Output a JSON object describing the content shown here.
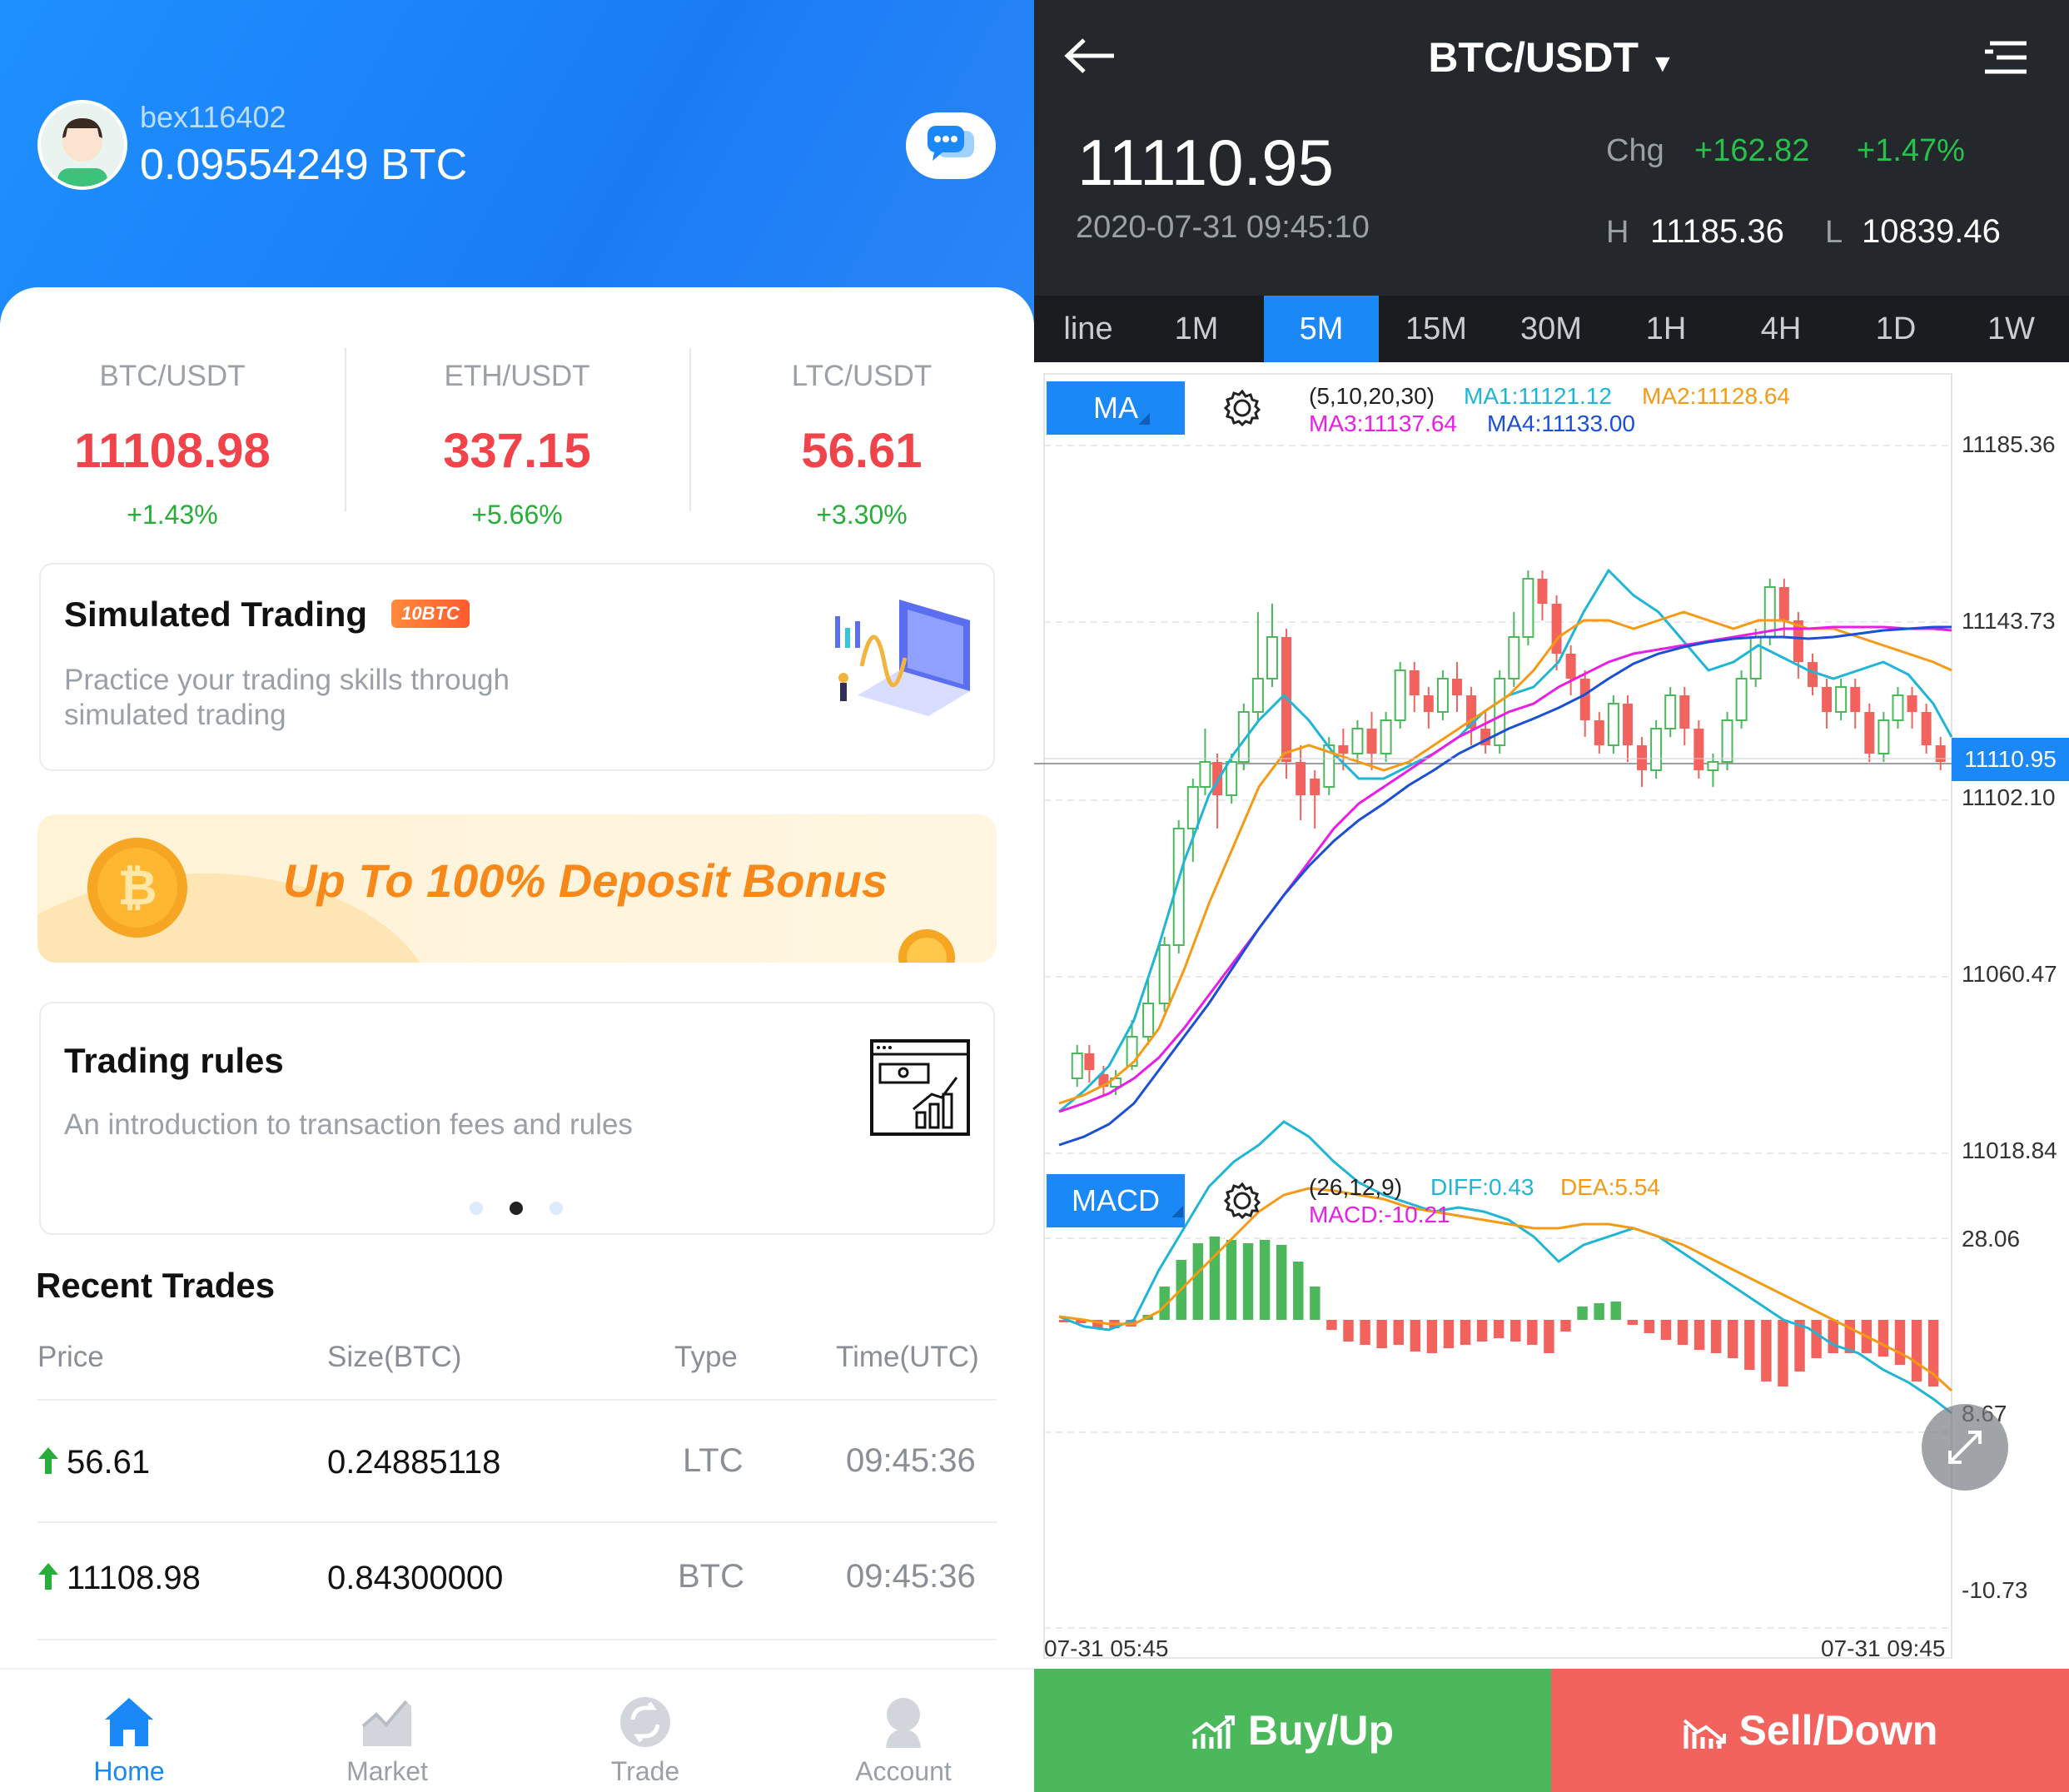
{
  "left": {
    "user": {
      "name": "bex116402",
      "balance": "0.09554249 BTC"
    },
    "tickers": [
      {
        "pair": "BTC/USDT",
        "price": "11108.98",
        "change": "+1.43%"
      },
      {
        "pair": "ETH/USDT",
        "price": "337.15",
        "change": "+5.66%"
      },
      {
        "pair": "LTC/USDT",
        "price": "56.61",
        "change": "+3.30%"
      }
    ],
    "sim_card": {
      "title": "Simulated Trading",
      "tag": "10BTC",
      "sub1": "Practice your trading skills through",
      "sub2": "simulated trading"
    },
    "banner": {
      "text": "Up To 100% Deposit Bonus"
    },
    "rules_card": {
      "title": "Trading rules",
      "sub": "An introduction to transaction fees and rules"
    },
    "recent": {
      "title": "Recent Trades",
      "headers": [
        "Price",
        "Size(BTC)",
        "Type",
        "Time(UTC)"
      ],
      "rows": [
        {
          "price": "56.61",
          "size": "0.24885118",
          "type": "LTC",
          "time": "09:45:36"
        },
        {
          "price": "11108.98",
          "size": "0.84300000",
          "type": "BTC",
          "time": "09:45:36"
        }
      ]
    },
    "nav": [
      {
        "label": "Home",
        "active": true
      },
      {
        "label": "Market",
        "active": false
      },
      {
        "label": "Trade",
        "active": false
      },
      {
        "label": "Account",
        "active": false
      }
    ],
    "colors": {
      "accent": "#1a88f7",
      "up": "#27ae3a",
      "down": "#f0434a"
    }
  },
  "right": {
    "title": "BTC/USDT",
    "price": "11110.95",
    "timestamp": "2020-07-31 09:45:10",
    "chg_label": "Chg",
    "chg_value": "+162.82",
    "chg_pct": "+1.47%",
    "high_label": "H",
    "high": "11185.36",
    "low_label": "L",
    "low": "10839.46",
    "tabs": [
      "line",
      "1M",
      "5M",
      "15M",
      "30M",
      "1H",
      "4H",
      "1D",
      "1W"
    ],
    "active_tab": "5M",
    "ma": {
      "button": "MA",
      "params": "(5,10,20,30)",
      "ma1": "MA1:11121.12",
      "ma2": "MA2:11128.64",
      "ma3": "MA3:11137.64",
      "ma4": "MA4:11133.00"
    },
    "price_axis": [
      "11185.36",
      "11143.73",
      "11102.10",
      "11060.47",
      "11018.84"
    ],
    "current_price_tag": "11110.95",
    "macd": {
      "button": "MACD",
      "params": "(26,12,9)",
      "diff": "DIFF:0.43",
      "dea": "DEA:5.54",
      "macd": "MACD:-10.21"
    },
    "macd_axis": [
      "28.06",
      "8.67",
      "-10.73"
    ],
    "time_axis": [
      "07-31 05:45",
      "07-31 09:45"
    ],
    "buy_label": "Buy/Up",
    "sell_label": "Sell/Down",
    "colors": {
      "buy": "#4cb85c",
      "sell": "#f2635e",
      "ma1": "#1fb5d6",
      "ma2": "#f59a14",
      "ma3": "#e91ee6",
      "ma4": "#1a4fd6"
    }
  }
}
